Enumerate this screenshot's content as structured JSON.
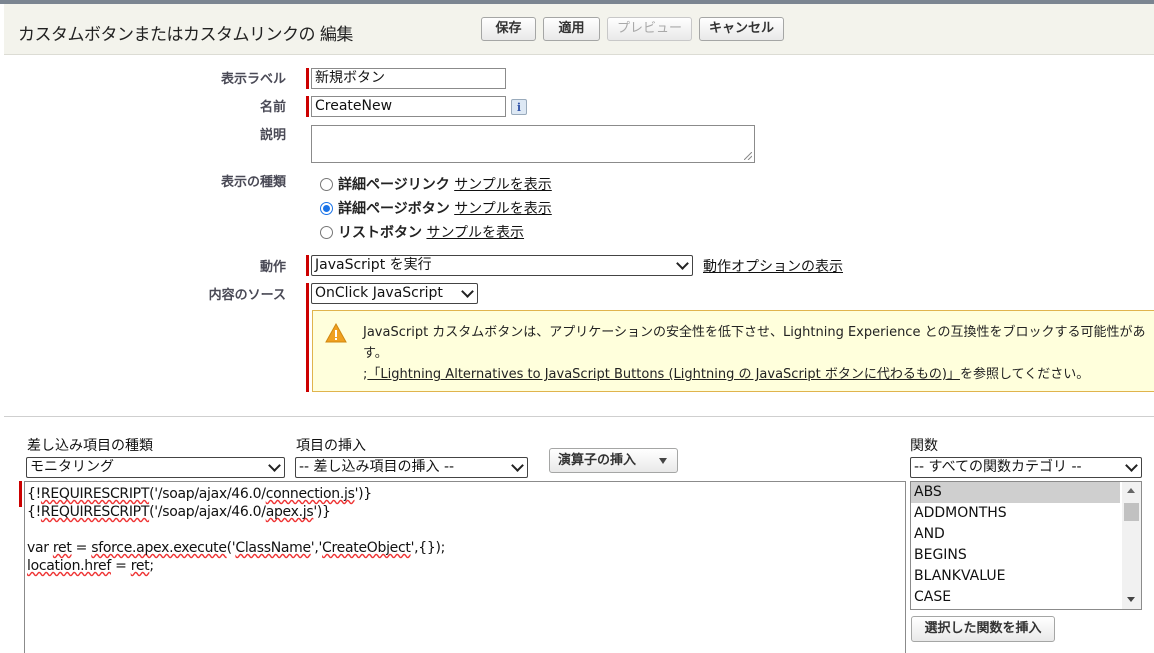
{
  "header": {
    "title": "カスタムボタンまたはカスタムリンクの 編集",
    "buttons": {
      "save": "保存",
      "apply": "適用",
      "preview": "プレビュー",
      "cancel": "キャンセル"
    }
  },
  "form": {
    "display_label": {
      "label": "表示ラベル",
      "value": "新規ボタン"
    },
    "name": {
      "label": "名前",
      "value": "CreateNew",
      "info_icon": "i"
    },
    "description": {
      "label": "説明",
      "value": ""
    },
    "display_type": {
      "label": "表示の種類",
      "options": [
        {
          "label": "詳細ページリンク",
          "link": "サンプルを表示",
          "checked": false
        },
        {
          "label": "詳細ページボタン",
          "link": "サンプルを表示",
          "checked": true
        },
        {
          "label": "リストボタン",
          "link": "サンプルを表示",
          "checked": false
        }
      ]
    },
    "behavior": {
      "label": "動作",
      "value": "JavaScript を実行",
      "link": "動作オプションの表示"
    },
    "content_source": {
      "label": "内容のソース",
      "value": "OnClick JavaScript"
    }
  },
  "warning": {
    "line1": "JavaScript カスタムボタンは、アプリケーションの安全性を低下させ、Lightning Experience との互換性をブロックする可能性があ",
    "line2": "す。",
    "link": "「Lightning Alternatives to JavaScript Buttons (Lightning の JavaScript ボタンに代わるもの)」",
    "link_suffix": "を参照してください。",
    "link_prefix": ";"
  },
  "editor": {
    "merge_field_type": {
      "label": "差し込み項目の種類",
      "value": "モニタリング"
    },
    "insert_field": {
      "label": "項目の挿入",
      "value": "-- 差し込み項目の挿入 --"
    },
    "operator_button": "演算子の挿入",
    "code_lines": [
      "{!REQUIRESCRIPT('/soap/ajax/46.0/connection.js')}",
      "{!REQUIRESCRIPT('/soap/ajax/46.0/apex.js')}",
      "",
      "var ret = sforce.apex.execute('ClassName','CreateObject',{});",
      "location.href = ret;"
    ]
  },
  "functions": {
    "label": "関数",
    "category": "-- すべての関数カテゴリ --",
    "items": [
      "ABS",
      "ADDMONTHS",
      "AND",
      "BEGINS",
      "BLANKVALUE",
      "CASE"
    ],
    "selected": "ABS",
    "insert_button": "選択した関数を挿入"
  },
  "colors": {
    "required": "#cc0000",
    "warning_bg": "#ffffdc",
    "warning_border": "#e0b44d",
    "header_bg": "#f3f3ec"
  }
}
